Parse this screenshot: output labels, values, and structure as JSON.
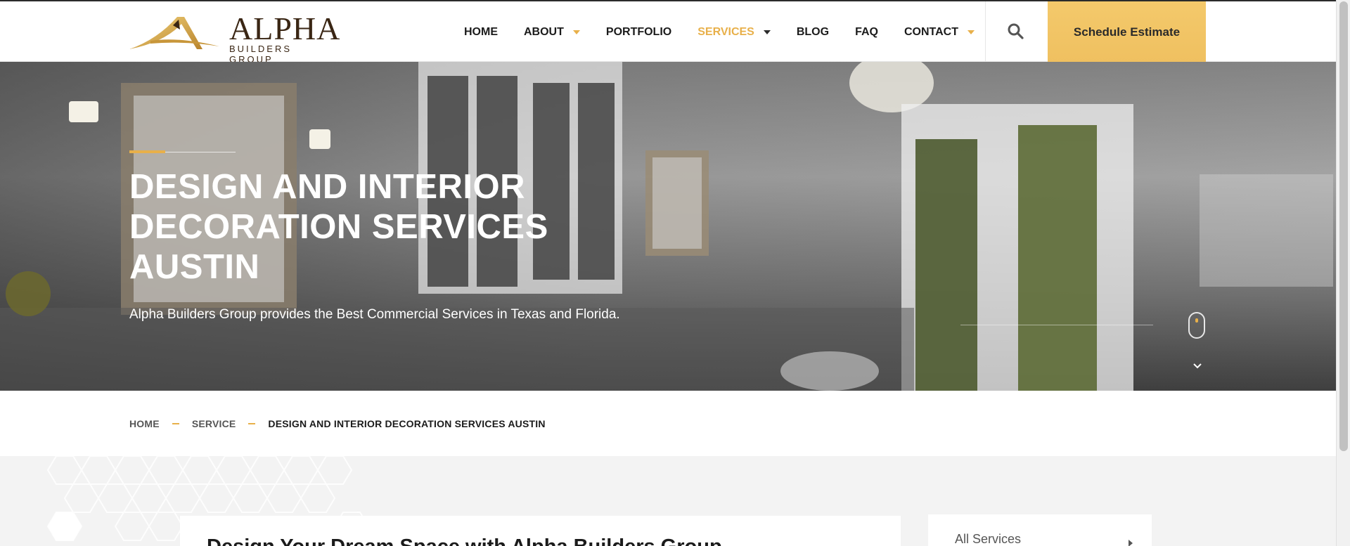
{
  "brand": {
    "word": "ALPHA",
    "sub": "BUILDERS GROUP",
    "logo_icon": "a-peak-logo-icon",
    "gold": "#e8b04a",
    "dark": "#3a2614"
  },
  "nav": {
    "items": [
      {
        "label": "HOME"
      },
      {
        "label": "ABOUT"
      },
      {
        "label": "PORTFOLIO"
      },
      {
        "label": "SERVICES"
      },
      {
        "label": "BLOG"
      },
      {
        "label": "FAQ"
      },
      {
        "label": "CONTACT"
      }
    ],
    "active": "SERVICES",
    "search_icon": "search-icon",
    "cta_label": "Schedule Estimate",
    "cta_color": "#f4c96b"
  },
  "hero": {
    "title": "DESIGN AND INTERIOR DECORATION SERVICES AUSTIN",
    "description": "Alpha Builders Group provides the Best Commercial Services in Texas and Florida.",
    "scroll_icon": "mouse-scroll-icon",
    "chevron_icon": "chevron-down-icon"
  },
  "breadcrumb": {
    "items": [
      "HOME",
      "SERVICE",
      "DESIGN AND INTERIOR DECORATION SERVICES AUSTIN"
    ]
  },
  "content": {
    "heading": "Design Your Dream Space with Alpha Builders Group"
  },
  "sidebar": {
    "first_item": "All Services",
    "arrow_icon": "chevron-right-icon"
  }
}
